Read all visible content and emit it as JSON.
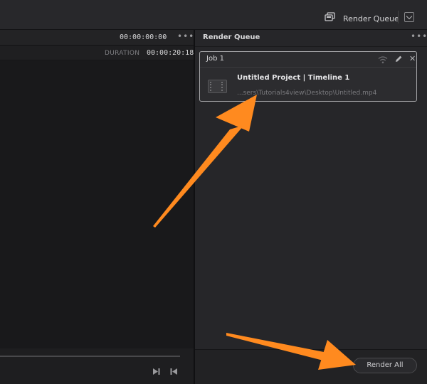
{
  "topbar": {
    "render_queue_label": "Render Queue",
    "icon": "render-queue-icon"
  },
  "viewer": {
    "timecode": "00:00:00:00",
    "duration_label": "DURATION",
    "duration_value": "00:00:20:18"
  },
  "render_queue": {
    "title": "Render Queue",
    "jobs": [
      {
        "label": "Job 1",
        "name": "Untitled Project | Timeline 1",
        "path": "...sers\\Tutorials4view\\Desktop\\Untitled.mp4"
      }
    ],
    "render_all_label": "Render All"
  },
  "colors": {
    "annotation_arrow": "#ff8a1f",
    "panel_bg": "#262629",
    "viewer_bg": "#19191b"
  }
}
